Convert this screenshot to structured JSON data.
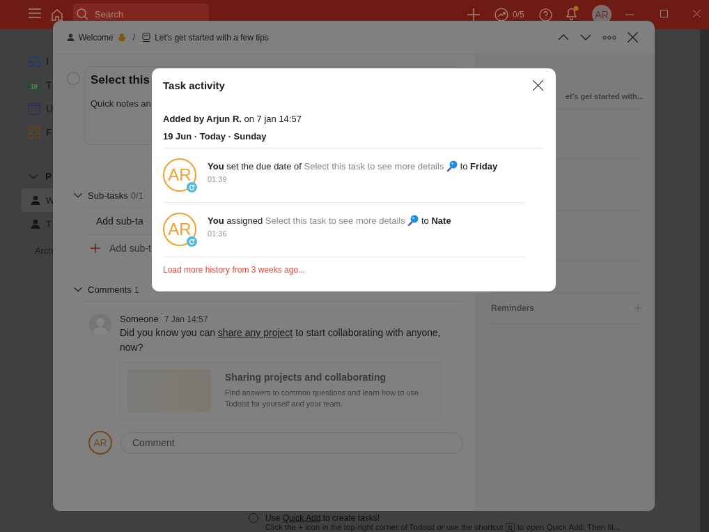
{
  "top_bar": {
    "search": {
      "placeholder": "Search"
    },
    "productivity": "0/5",
    "avatar": "AR",
    "notifications_unread": true
  },
  "sidebar": {
    "items": [
      {
        "label": "I",
        "kind": "inbox"
      },
      {
        "label": "T",
        "kind": "today",
        "icon_text": "19"
      },
      {
        "label": "U",
        "kind": "upcoming"
      },
      {
        "label": "F",
        "kind": "filters"
      }
    ],
    "projects_header": "P",
    "projects_expanded": true,
    "projects": [
      {
        "label": "W",
        "selected": true
      },
      {
        "label": "T",
        "selected": false
      }
    ],
    "archive_link": "Arch"
  },
  "task_dialog": {
    "breadcrumb": [
      {
        "label": "Welcome",
        "kind": "project"
      },
      {
        "label": "Let's get started with a few tips",
        "kind": "section"
      }
    ],
    "separator": "/",
    "completed": false,
    "title": "Select this",
    "description": "Quick notes an",
    "subtasks": {
      "label": "Sub-tasks",
      "count": "0/1",
      "expanded": true,
      "items": [
        {
          "label": "Add sub-ta",
          "kind": "task"
        },
        {
          "label": "Add sub-t",
          "kind": "add"
        }
      ]
    },
    "comments": {
      "label": "Comments",
      "count": "1",
      "expanded": true,
      "items": [
        {
          "author": "Someone",
          "time": "7 Jan 14:57",
          "text_before": "Did you know you can ",
          "link": "share any project",
          "text_after": " to start collaborating with anyone, now?",
          "preview": {
            "title": "Sharing projects and collaborating",
            "description": "Find answers to common questions and learn how to use Todoist for yourself and your team."
          }
        }
      ],
      "input": {
        "avatar": "AR",
        "placeholder": "Comment"
      }
    },
    "details": {
      "section": "et's get started with...",
      "reminders_label": "Reminders"
    }
  },
  "background_task": {
    "completed": false,
    "title_before": "Use ",
    "title_link": "Quick Add",
    "title_after": " to create tasks!",
    "hint_before": "Click the + icon in the top-right corner of Todoist *or* use the shortcut",
    "shortcut": "q",
    "hint_after": "to open Quick Add. Then fil..."
  },
  "activity_modal": {
    "title": "Task activity",
    "added": "**Added by Arjun R.** on 7 jan 14:57",
    "day": "19 Jun · Today · Sunday",
    "entries": [
      {
        "avatar": "AR",
        "before": "**You** set the due date of ",
        "task": "Select this task to see more details",
        "after": " to **Friday**",
        "time": "01:39"
      },
      {
        "avatar": "AR",
        "before": "**You** assigned ",
        "task": "Select this task to see more details",
        "after": " to **Nate**",
        "time": "01:36"
      }
    ],
    "load_more": "Load more history from 3 weeks ago..."
  }
}
